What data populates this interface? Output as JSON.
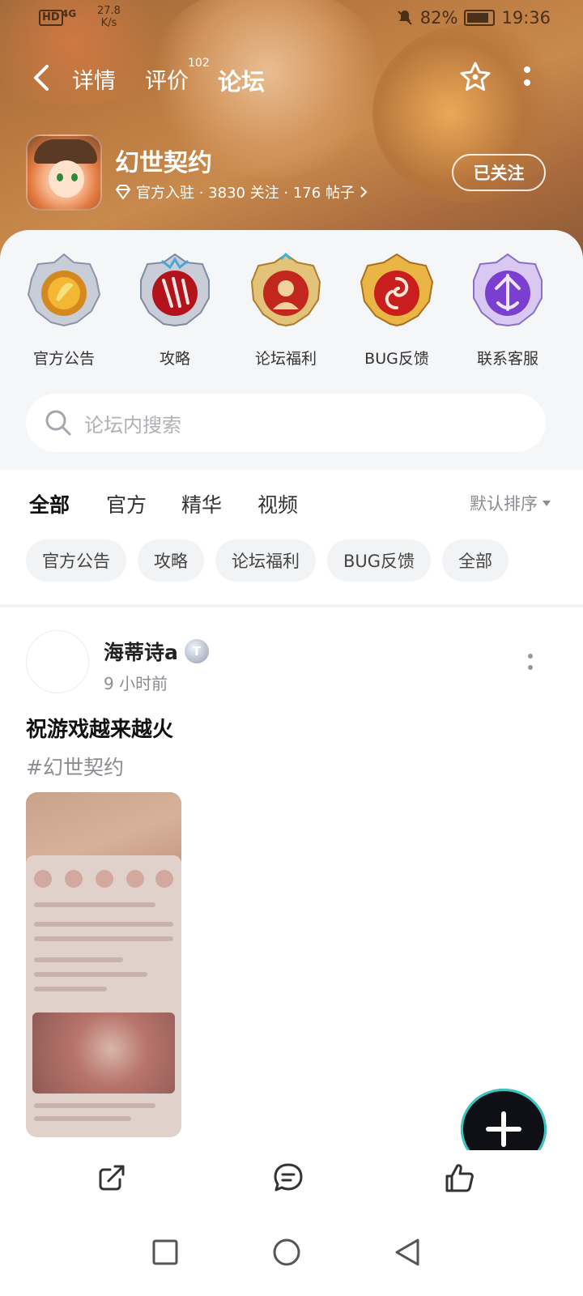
{
  "status_bar": {
    "hd": "HD",
    "network": "4G",
    "speed_value": "27.8",
    "speed_unit": "K/s",
    "battery": "82%",
    "time": "19:36"
  },
  "nav": {
    "tabs": [
      {
        "label": "详情"
      },
      {
        "label": "评价",
        "badge": "102"
      },
      {
        "label": "论坛"
      }
    ]
  },
  "game": {
    "title": "幻世契约",
    "meta": "官方入驻 · 3830 关注 · 176 帖子",
    "follow_label": "已关注"
  },
  "categories": [
    {
      "label": "官方公告"
    },
    {
      "label": "攻略"
    },
    {
      "label": "论坛福利"
    },
    {
      "label": "BUG反馈"
    },
    {
      "label": "联系客服"
    }
  ],
  "search": {
    "placeholder": "论坛内搜索"
  },
  "filter_tabs": [
    {
      "label": "全部"
    },
    {
      "label": "官方"
    },
    {
      "label": "精华"
    },
    {
      "label": "视频"
    }
  ],
  "sort_label": "默认排序",
  "chips": [
    {
      "label": "官方公告"
    },
    {
      "label": "攻略"
    },
    {
      "label": "论坛福利"
    },
    {
      "label": "BUG反馈"
    },
    {
      "label": "全部"
    }
  ],
  "post": {
    "author": "海蒂诗a",
    "level_badge": "T",
    "time": "9 小时前",
    "title": "祝游戏越来越火",
    "tag": "#幻世契约"
  },
  "colors": {
    "accent": "#27c7b4",
    "banner": "#b9783f",
    "card_bg": "#f5f6f8"
  },
  "icons": {
    "nav": [
      "back-icon",
      "star-icon",
      "more-icon"
    ],
    "actions": [
      "share-icon",
      "comment-icon",
      "like-icon"
    ],
    "system": [
      "recent-apps-icon",
      "home-icon",
      "back-nav-icon"
    ]
  }
}
